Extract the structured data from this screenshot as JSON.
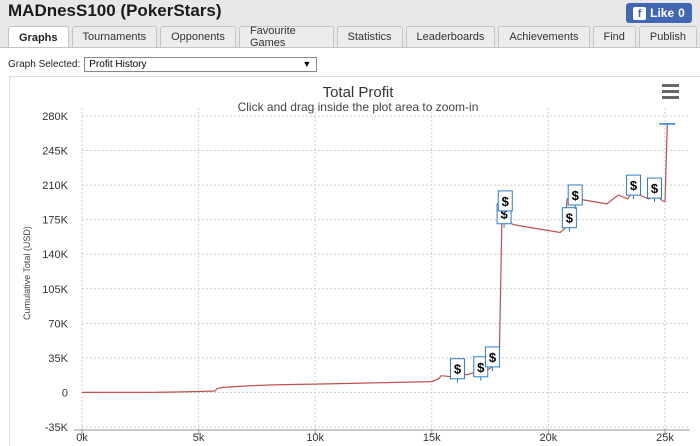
{
  "header": {
    "player_name": "MADnesS100 (PokerStars)",
    "like_label": "Like",
    "like_count": "0"
  },
  "tabs": [
    {
      "label": "Graphs",
      "active": true
    },
    {
      "label": "Tournaments",
      "active": false
    },
    {
      "label": "Opponents",
      "active": false
    },
    {
      "label": "Favourite Games",
      "active": false
    },
    {
      "label": "Statistics",
      "active": false
    },
    {
      "label": "Leaderboards",
      "active": false
    },
    {
      "label": "Achievements",
      "active": false
    },
    {
      "label": "Find",
      "active": false
    },
    {
      "label": "Publish",
      "active": false
    }
  ],
  "graph_selector": {
    "label": "Graph Selected:",
    "value": "Profit History"
  },
  "chart_data": {
    "type": "line",
    "title": "Total Profit",
    "subtitle": "Click and drag inside the plot area to zoom-in",
    "xlabel": "",
    "ylabel": "Cumulative Total (USD)",
    "xlim": [
      0,
      25500
    ],
    "ylim": [
      -35000,
      280000
    ],
    "x_ticks": [
      "0k",
      "5k",
      "10k",
      "15k",
      "20k",
      "25k"
    ],
    "x_tick_values": [
      0,
      5000,
      10000,
      15000,
      20000,
      25000
    ],
    "y_ticks": [
      "-35K",
      "0",
      "35K",
      "70K",
      "105K",
      "140K",
      "175K",
      "210K",
      "245K",
      "280K"
    ],
    "y_tick_values": [
      -35000,
      0,
      35000,
      70000,
      105000,
      140000,
      175000,
      210000,
      245000,
      280000
    ],
    "grid": true,
    "line_color": "#c0504d",
    "marker_color": "#2a7fc9",
    "series": [
      {
        "x": [
          0,
          500,
          1000,
          2000,
          3000,
          4000,
          5000,
          5700,
          5800,
          6000,
          7000,
          8000,
          9000,
          10000,
          11000,
          12000,
          13000,
          14000,
          15000,
          15300,
          15400,
          15800,
          16000,
          16300,
          16500,
          16800,
          17000,
          17200,
          17400,
          17600,
          17800,
          17900,
          18000,
          18050,
          18100,
          18500,
          19000,
          19500,
          20000,
          20500,
          20700,
          20800,
          21000,
          21500,
          22000,
          22500,
          23000,
          23400,
          23600,
          24000,
          24300,
          24600,
          24900,
          25000,
          25100
        ],
        "y": [
          0,
          0,
          0,
          0,
          0,
          500,
          1000,
          1500,
          4000,
          5000,
          6500,
          7500,
          8000,
          8500,
          9000,
          9500,
          10000,
          10500,
          11000,
          14000,
          17000,
          16000,
          22000,
          19000,
          18000,
          20000,
          25000,
          22000,
          23000,
          26000,
          30000,
          40000,
          170000,
          185000,
          175000,
          170000,
          168000,
          166000,
          164000,
          162000,
          166000,
          196000,
          198000,
          195000,
          193000,
          191000,
          200000,
          196000,
          203000,
          199000,
          196000,
          200000,
          194000,
          193000,
          272000
        ]
      }
    ],
    "markers": [
      {
        "x": 16100,
        "y": 24000,
        "label": "$"
      },
      {
        "x": 17100,
        "y": 26000,
        "label": "$"
      },
      {
        "x": 17600,
        "y": 36000,
        "label": "$"
      },
      {
        "x": 18100,
        "y": 181000,
        "label": "$"
      },
      {
        "x": 18150,
        "y": 194000,
        "label": "$"
      },
      {
        "x": 20900,
        "y": 177000,
        "label": "$"
      },
      {
        "x": 21150,
        "y": 200000,
        "label": "$"
      },
      {
        "x": 23650,
        "y": 210000,
        "label": "$"
      },
      {
        "x": 24550,
        "y": 207000,
        "label": "$"
      }
    ]
  }
}
